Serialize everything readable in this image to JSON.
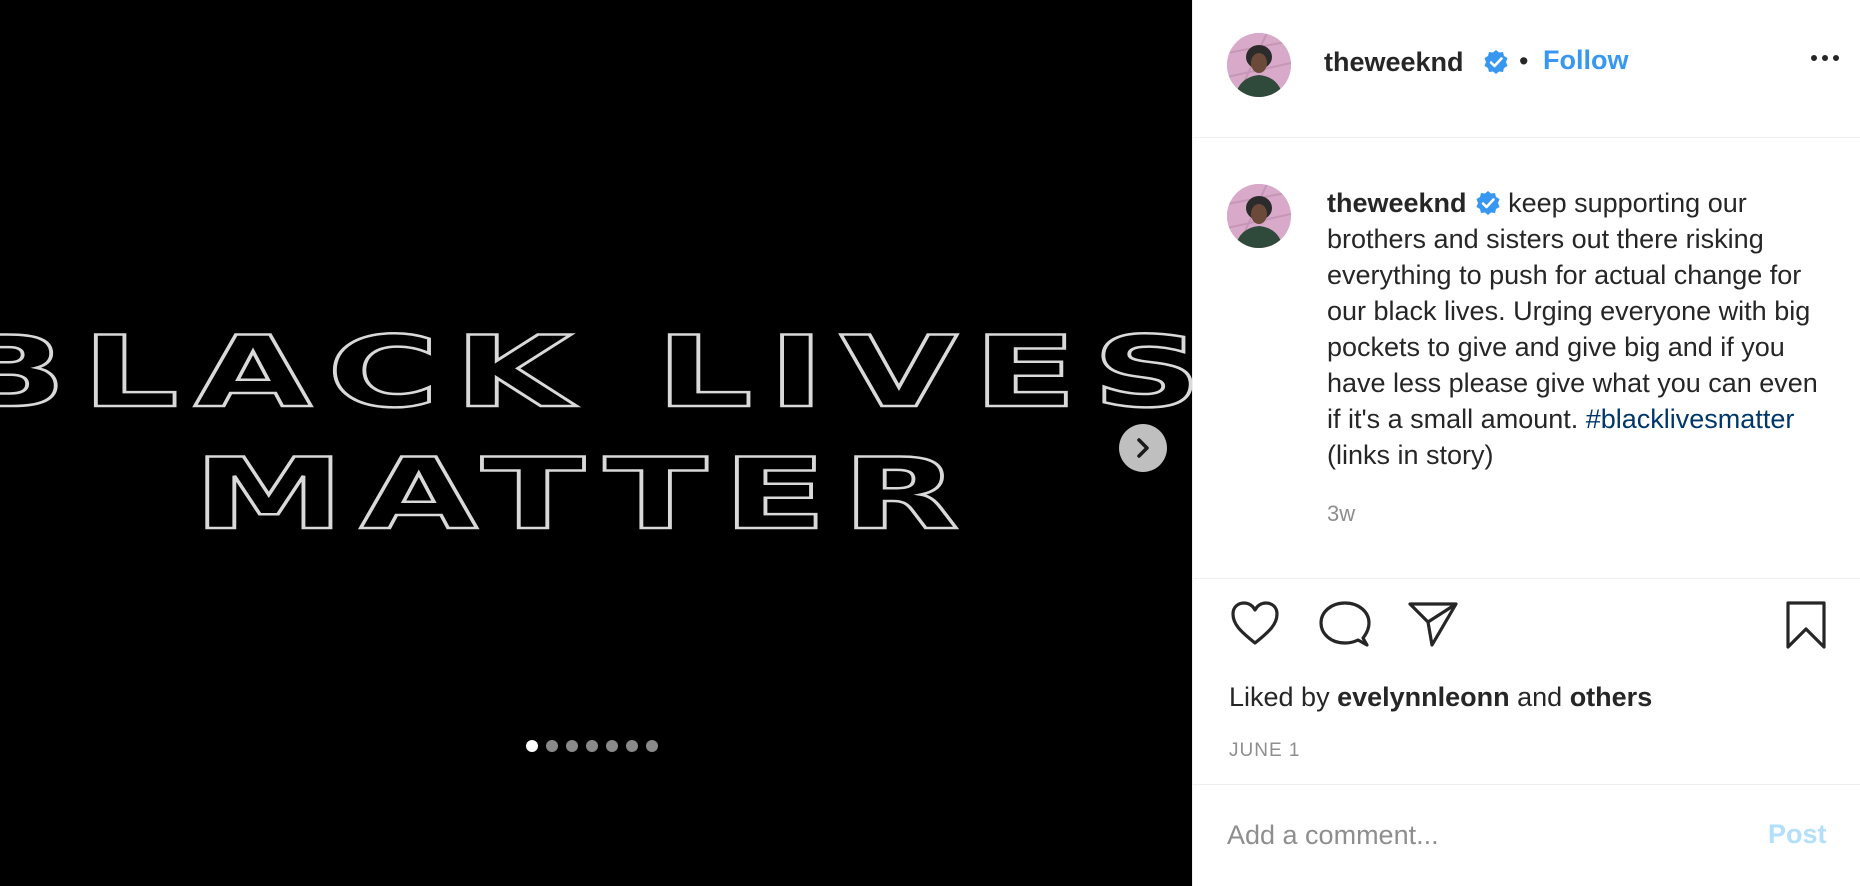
{
  "media": {
    "line1": "BLACK LIVES",
    "line2": "MATTER",
    "carousel": {
      "count": 7,
      "active_index": 0
    }
  },
  "header": {
    "username": "theweeknd",
    "bullet": "•",
    "follow_label": "Follow"
  },
  "caption": {
    "username": "theweeknd",
    "text": "keep supporting our brothers and sisters out there risking everything to push for actual change for our black lives. Urging everyone with big pockets to give and give big and if you have less please give what you can even if it's a small amount. ",
    "hashtag": "#blacklivesmatter",
    "suffix": " (links in story)",
    "time": "3w"
  },
  "likes": {
    "prefix": "Liked by ",
    "user": "evelynnleonn",
    "middle": " and ",
    "others": "others"
  },
  "date": "JUNE 1",
  "comment": {
    "placeholder": "Add a comment...",
    "post_label": "Post"
  },
  "colors": {
    "accent": "#3897f0",
    "verified": "#3897f0",
    "hashtag": "#00376b",
    "post_disabled": "#b2dffc"
  }
}
